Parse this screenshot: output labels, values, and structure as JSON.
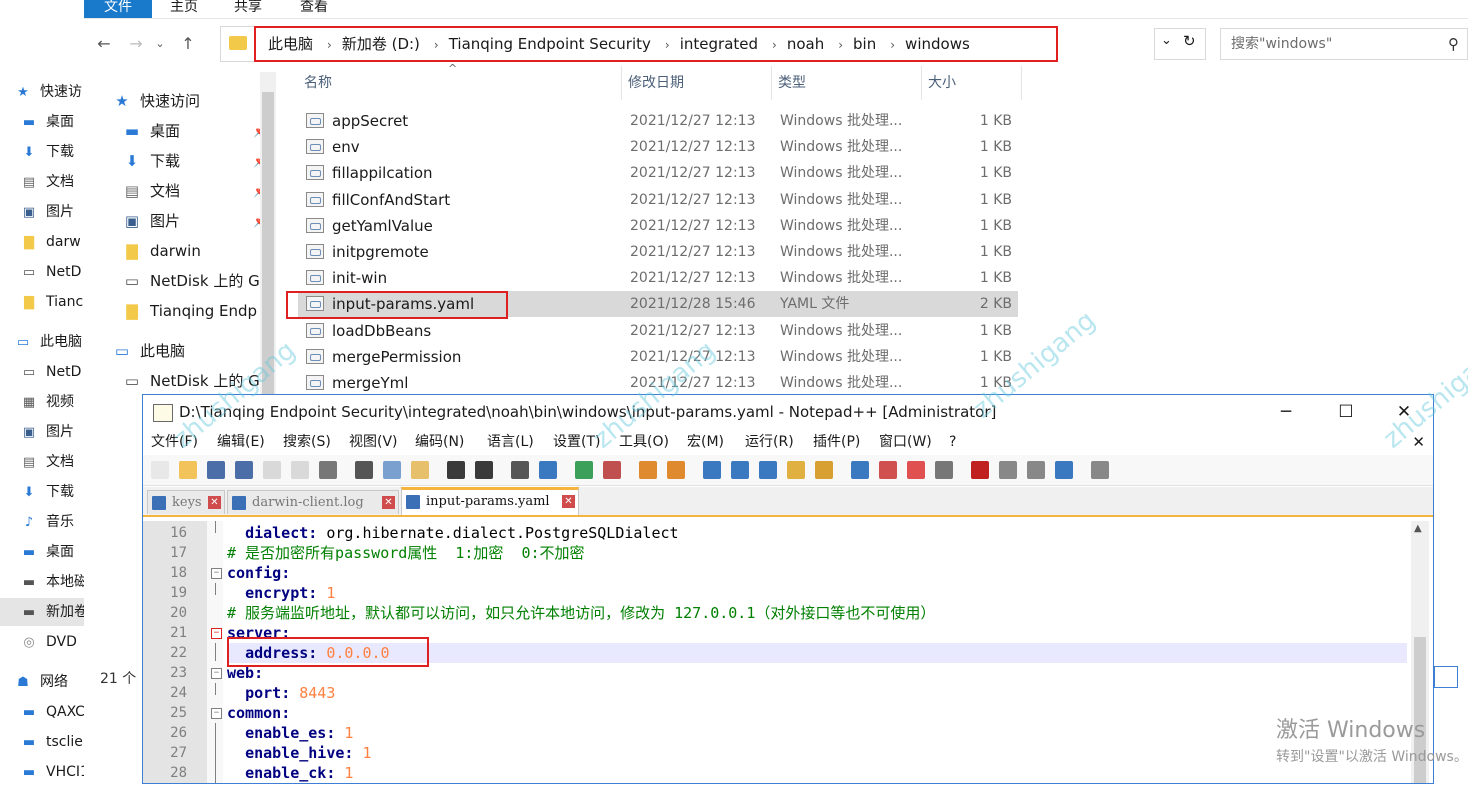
{
  "bg_explorer": {
    "nav_items": [
      {
        "label": "快速访",
        "icon": "star-icon"
      },
      {
        "label": "桌面",
        "icon": "desktop-icon"
      },
      {
        "label": "下载",
        "icon": "download-icon"
      },
      {
        "label": "文档",
        "icon": "document-icon"
      },
      {
        "label": "图片",
        "icon": "picture-icon"
      },
      {
        "label": "darw",
        "icon": "folder-icon"
      },
      {
        "label": "NetD",
        "icon": "netdisk-icon"
      },
      {
        "label": "Tianc",
        "icon": "folder-icon"
      },
      {
        "label": "此电脑",
        "icon": "pc-icon"
      },
      {
        "label": "NetD",
        "icon": "netdisk-icon"
      },
      {
        "label": "视频",
        "icon": "video-icon"
      },
      {
        "label": "图片",
        "icon": "picture-icon"
      },
      {
        "label": "文档",
        "icon": "document-icon"
      },
      {
        "label": "下载",
        "icon": "download-icon"
      },
      {
        "label": "音乐",
        "icon": "music-icon"
      },
      {
        "label": "桌面",
        "icon": "desktop-icon"
      },
      {
        "label": "本地磁",
        "icon": "disk-icon"
      },
      {
        "label": "新加卷",
        "icon": "disk-icon"
      },
      {
        "label": "DVD",
        "icon": "dvd-icon"
      },
      {
        "label": "网络",
        "icon": "network-icon"
      },
      {
        "label": "QAXCICDWIN",
        "icon": "computer-icon"
      },
      {
        "label": "tsclient",
        "icon": "computer-icon"
      },
      {
        "label": "VHCI10V",
        "icon": "computer-icon"
      }
    ]
  },
  "explorer": {
    "ribbon_tabs": [
      "文件",
      "主页",
      "共享",
      "查看"
    ],
    "breadcrumbs": [
      "此电脑",
      "新加卷 (D:)",
      "Tianqing Endpoint Security",
      "integrated",
      "noah",
      "bin",
      "windows"
    ],
    "search_placeholder": "搜索\"windows\"",
    "columns": {
      "name": "名称",
      "date": "修改日期",
      "type": "类型",
      "size": "大小"
    },
    "nav": [
      {
        "label": "快速访问",
        "icon": "star-icon",
        "pin": false
      },
      {
        "label": "桌面",
        "icon": "desktop-icon",
        "pin": true
      },
      {
        "label": "下载",
        "icon": "download-icon",
        "pin": true
      },
      {
        "label": "文档",
        "icon": "document-icon",
        "pin": true
      },
      {
        "label": "图片",
        "icon": "picture-icon",
        "pin": true
      },
      {
        "label": "darwin",
        "icon": "folder-icon",
        "pin": false
      },
      {
        "label": "NetDisk 上的 G",
        "icon": "netdisk-icon",
        "pin": false
      },
      {
        "label": "Tianqing Endp",
        "icon": "folder-icon",
        "pin": false
      },
      {
        "label": "此电脑",
        "icon": "pc-icon",
        "pin": false
      },
      {
        "label": "NetDisk 上的 G",
        "icon": "netdisk-icon",
        "pin": false
      }
    ],
    "files": [
      {
        "name": "appSecret",
        "date": "2021/12/27 12:13",
        "type": "Windows 批处理...",
        "size": "1 KB"
      },
      {
        "name": "env",
        "date": "2021/12/27 12:13",
        "type": "Windows 批处理...",
        "size": "1 KB"
      },
      {
        "name": "fillappilcation",
        "date": "2021/12/27 12:13",
        "type": "Windows 批处理...",
        "size": "1 KB"
      },
      {
        "name": "fillConfAndStart",
        "date": "2021/12/27 12:13",
        "type": "Windows 批处理...",
        "size": "1 KB"
      },
      {
        "name": "getYamlValue",
        "date": "2021/12/27 12:13",
        "type": "Windows 批处理...",
        "size": "1 KB"
      },
      {
        "name": "initpgremote",
        "date": "2021/12/27 12:13",
        "type": "Windows 批处理...",
        "size": "1 KB"
      },
      {
        "name": "init-win",
        "date": "2021/12/27 12:13",
        "type": "Windows 批处理...",
        "size": "1 KB"
      },
      {
        "name": "input-params.yaml",
        "date": "2021/12/28 15:46",
        "type": "YAML 文件",
        "size": "2 KB",
        "selected": true
      },
      {
        "name": "loadDbBeans",
        "date": "2021/12/27 12:13",
        "type": "Windows 批处理...",
        "size": "1 KB"
      },
      {
        "name": "mergePermission",
        "date": "2021/12/27 12:13",
        "type": "Windows 批处理...",
        "size": "1 KB"
      },
      {
        "name": "mergeYml",
        "date": "2021/12/27 12:13",
        "type": "Windows 批处理...",
        "size": "1 KB"
      }
    ],
    "item_count": "21 个"
  },
  "npp": {
    "title": "D:\\Tianqing Endpoint Security\\integrated\\noah\\bin\\windows\\input-params.yaml - Notepad++ [Administrator]",
    "menu": [
      "文件(F)",
      "编辑(E)",
      "搜索(S)",
      "视图(V)",
      "编码(N)",
      "语言(L)",
      "设置(T)",
      "工具(O)",
      "宏(M)",
      "运行(R)",
      "插件(P)",
      "窗口(W)",
      "?"
    ],
    "tabs": [
      {
        "label": "keys",
        "active": false
      },
      {
        "label": "darwin-client.log",
        "active": false
      },
      {
        "label": "input-params.yaml",
        "active": true
      }
    ],
    "lines": [
      {
        "n": "16",
        "indent": "  ",
        "key": "dialect",
        "val": "org.hibernate.dialect.PostgreSQLDialect",
        "valtype": "s"
      },
      {
        "n": "17",
        "comment": "# 是否加密所有password属性  1:加密  0:不加密"
      },
      {
        "n": "18",
        "indent": "",
        "key": "config",
        "val": "",
        "valtype": "s"
      },
      {
        "n": "19",
        "indent": "  ",
        "key": "encrypt",
        "val": "1",
        "valtype": "v"
      },
      {
        "n": "20",
        "comment": "# 服务端监听地址，默认都可以访问，如只允许本地访问，修改为 127.0.0.1（对外接口等也不可使用）"
      },
      {
        "n": "21",
        "indent": "",
        "key": "server",
        "val": "",
        "valtype": "s"
      },
      {
        "n": "22",
        "indent": "  ",
        "key": "address",
        "val": "0.0.0.0",
        "valtype": "v",
        "current": true
      },
      {
        "n": "23",
        "indent": "",
        "key": "web",
        "val": "",
        "valtype": "s"
      },
      {
        "n": "24",
        "indent": "  ",
        "key": "port",
        "val": "8443",
        "valtype": "v"
      },
      {
        "n": "25",
        "indent": "",
        "key": "common",
        "val": "",
        "valtype": "s"
      },
      {
        "n": "26",
        "indent": "  ",
        "key": "enable_es",
        "val": "1",
        "valtype": "v"
      },
      {
        "n": "27",
        "indent": "  ",
        "key": "enable_hive",
        "val": "1",
        "valtype": "v"
      },
      {
        "n": "28",
        "indent": "  ",
        "key": "enable_ck",
        "val": "1",
        "valtype": "v"
      }
    ]
  },
  "watermark": "zhushigang",
  "activation": {
    "line1": "激活 Windows",
    "line2": "转到\"设置\"以激活 Windows。"
  }
}
